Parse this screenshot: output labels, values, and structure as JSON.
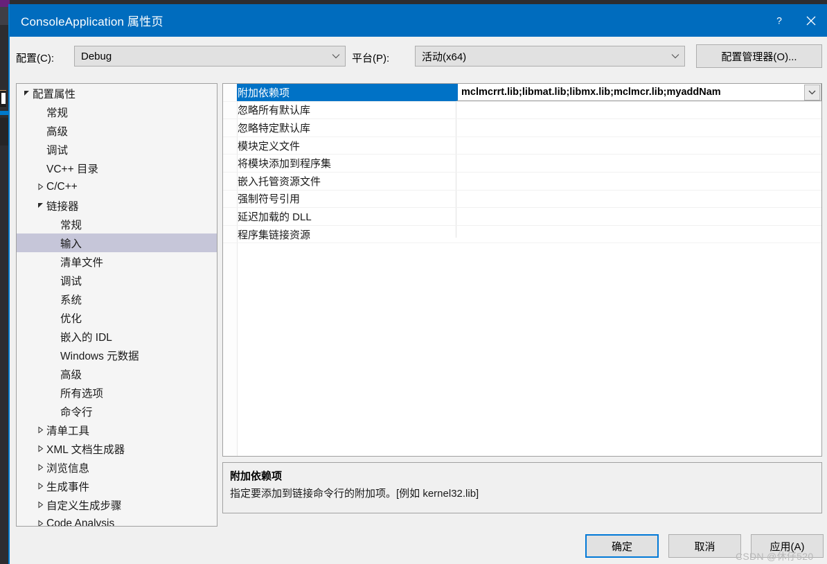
{
  "window": {
    "title": "ConsoleApplication 属性页",
    "help_icon": "?",
    "close_icon": "×",
    "accent_color": "#006cbe",
    "focus_color": "#0078d7"
  },
  "config_bar": {
    "config_label": "配置(C):",
    "config_value": "Debug",
    "platform_label": "平台(P):",
    "platform_value": "活动(x64)",
    "config_manager_button": "配置管理器(O)..."
  },
  "tree": {
    "selected": "输入",
    "selection_color": "#c6c6d9",
    "items": [
      {
        "label": "配置属性",
        "indent": 0,
        "arrow": "expanded"
      },
      {
        "label": "常规",
        "indent": 1,
        "arrow": "none"
      },
      {
        "label": "高级",
        "indent": 1,
        "arrow": "none"
      },
      {
        "label": "调试",
        "indent": 1,
        "arrow": "none"
      },
      {
        "label": "VC++ 目录",
        "indent": 1,
        "arrow": "none"
      },
      {
        "label": "C/C++",
        "indent": 1,
        "arrow": "collapsed"
      },
      {
        "label": "链接器",
        "indent": 1,
        "arrow": "expanded"
      },
      {
        "label": "常规",
        "indent": 2,
        "arrow": "none"
      },
      {
        "label": "输入",
        "indent": 2,
        "arrow": "none",
        "selected": true
      },
      {
        "label": "清单文件",
        "indent": 2,
        "arrow": "none"
      },
      {
        "label": "调试",
        "indent": 2,
        "arrow": "none"
      },
      {
        "label": "系统",
        "indent": 2,
        "arrow": "none"
      },
      {
        "label": "优化",
        "indent": 2,
        "arrow": "none"
      },
      {
        "label": "嵌入的 IDL",
        "indent": 2,
        "arrow": "none"
      },
      {
        "label": "Windows 元数据",
        "indent": 2,
        "arrow": "none"
      },
      {
        "label": "高级",
        "indent": 2,
        "arrow": "none"
      },
      {
        "label": "所有选项",
        "indent": 2,
        "arrow": "none"
      },
      {
        "label": "命令行",
        "indent": 2,
        "arrow": "none"
      },
      {
        "label": "清单工具",
        "indent": 1,
        "arrow": "collapsed"
      },
      {
        "label": "XML 文档生成器",
        "indent": 1,
        "arrow": "collapsed"
      },
      {
        "label": "浏览信息",
        "indent": 1,
        "arrow": "collapsed"
      },
      {
        "label": "生成事件",
        "indent": 1,
        "arrow": "collapsed"
      },
      {
        "label": "自定义生成步骤",
        "indent": 1,
        "arrow": "collapsed"
      },
      {
        "label": "Code Analysis",
        "indent": 1,
        "arrow": "collapsed"
      }
    ]
  },
  "grid": {
    "selection_color": "#0072c6",
    "rows": [
      {
        "name": "附加依赖项",
        "value": "mclmcrrt.lib;libmat.lib;libmx.lib;mclmcr.lib;myaddNam",
        "selected": true,
        "has_dropdown": true
      },
      {
        "name": "忽略所有默认库",
        "value": ""
      },
      {
        "name": "忽略特定默认库",
        "value": ""
      },
      {
        "name": "模块定义文件",
        "value": ""
      },
      {
        "name": "将模块添加到程序集",
        "value": ""
      },
      {
        "name": "嵌入托管资源文件",
        "value": ""
      },
      {
        "name": "强制符号引用",
        "value": ""
      },
      {
        "name": "延迟加载的 DLL",
        "value": ""
      },
      {
        "name": "程序集链接资源",
        "value": ""
      }
    ]
  },
  "description": {
    "title": "附加依赖项",
    "body": "指定要添加到链接命令行的附加项。[例如 kernel32.lib]"
  },
  "buttons": {
    "ok": "确定",
    "cancel": "取消",
    "apply": "应用(A)"
  },
  "watermark": "CSDN @休仔520"
}
